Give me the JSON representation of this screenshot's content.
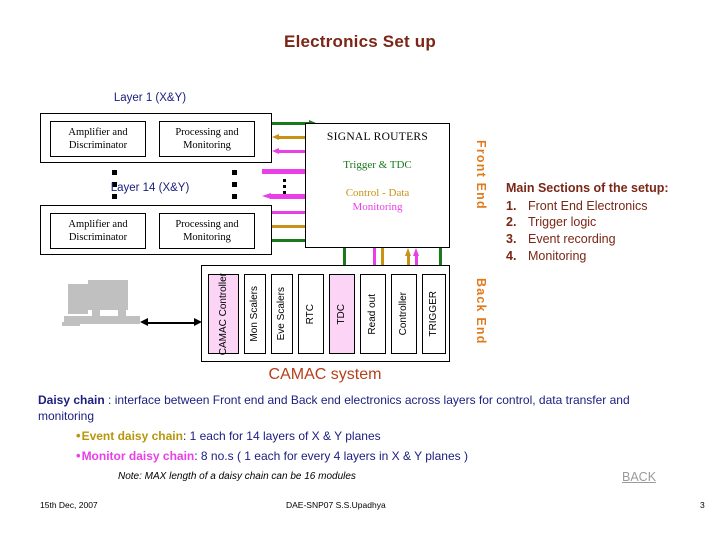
{
  "slide": {
    "title": "Electronics Set up"
  },
  "front_end": {
    "side_label": "Front End",
    "layer_top_label": "Layer 1 (X&Y)",
    "layer_bottom_label": "Layer 14 (X&Y)",
    "blocks": {
      "amplifier": "Amplifier and Discriminator",
      "processing": "Processing and Monitoring"
    }
  },
  "router": {
    "title": "SIGNAL ROUTERS",
    "trigger": "Trigger  & TDC",
    "control": "Control - Data",
    "monitoring": "Monitoring"
  },
  "back_end": {
    "side_label": "Back End",
    "camac_label": "CAMAC system",
    "modules": [
      {
        "name": "CAMAC Controller",
        "highlight": true
      },
      {
        "name": "Mon  Scalers",
        "highlight": false
      },
      {
        "name": "Eve  Scalers",
        "highlight": false
      },
      {
        "name": "RTC",
        "highlight": false
      },
      {
        "name": "TDC",
        "highlight": true
      },
      {
        "name": "Read out",
        "highlight": false
      },
      {
        "name": "Controller",
        "highlight": false
      },
      {
        "name": "TRIGGER",
        "highlight": false
      }
    ]
  },
  "sections": {
    "heading": "Main Sections of the setup:",
    "items": [
      {
        "num": "1.",
        "text": "Front End Electronics"
      },
      {
        "num": "2.",
        "text": "Trigger logic"
      },
      {
        "num": "3.",
        "text": "Event recording"
      },
      {
        "num": "4.",
        "text": "Monitoring"
      }
    ]
  },
  "daisy": {
    "lead_bold": "Daisy chain",
    "lead_rest": " : interface between Front end and Back end electronics across layers for control, data transfer and monitoring",
    "event_bold": "Event daisy chain",
    "event_rest": " : 1 each for 14 layers of X & Y planes",
    "monitor_bold": "Monitor daisy chain",
    "monitor_rest": ": 8 no.s ( 1 each for every 4 layers in X & Y planes )",
    "note": "Note:  MAX length of a daisy chain can be 16 modules",
    "back_link": "BACK"
  },
  "footer": {
    "date": "15th Dec, 2007",
    "center": "DAE-SNP07    S.S.Upadhya",
    "page": "3"
  },
  "colors": {
    "title": "#7b2616",
    "navy": "#1d2080",
    "green": "#1a7a1a",
    "gold": "#c79215",
    "magenta": "#e83fe8",
    "orange": "#e07b1d",
    "camac": "#b4401a",
    "pink_fill": "#fbd4f6"
  }
}
